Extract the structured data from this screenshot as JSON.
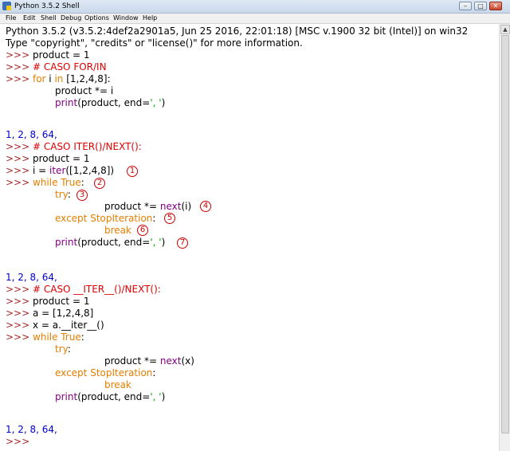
{
  "window": {
    "title": "Python 3.5.2 Shell",
    "icon": "python-icon"
  },
  "menu": [
    "File",
    "Edit",
    "Shell",
    "Debug",
    "Options",
    "Window",
    "Help"
  ],
  "shell": {
    "header1": "Python 3.5.2 (v3.5.2:4def2a2901a5, Jun 25 2016, 22:01:18) [MSC v.1900 32 bit (Intel)] on win32",
    "header2": "Type \"copyright\", \"credits\" or \"license()\" for more information.",
    "prompt": ">>> ",
    "b1": {
      "l1": "product = 1",
      "l2": "# CASO FOR/IN",
      "l3a": "for",
      "l3b": " i ",
      "l3c": "in",
      "l3d": " [1,2,4,8]:",
      "l4": "product *= i",
      "l5a": "print",
      "l5b": "(product, end=",
      "l5c": "', '",
      "l5d": ")"
    },
    "output1": "1, 2, 8, 64,",
    "b2": {
      "l1": "# CASO ITER()/NEXT():",
      "l2": "product = 1",
      "l3a": "i = ",
      "l3b": "iter",
      "l3c": "([1,2,4,8])",
      "l4a": "while",
      "l4b": " ",
      "l4c": "True",
      "l4d": ":",
      "l5a": "try",
      "l5b": ":",
      "l6a": "product *= ",
      "l6b": "next",
      "l6c": "(i)",
      "l7a": "except",
      "l7b": " ",
      "l7c": "StopIteration",
      "l7d": ":",
      "l8": "break",
      "l9a": "print",
      "l9b": "(product, end=",
      "l9c": "', '",
      "l9d": ")"
    },
    "markers": [
      "1",
      "2",
      "3",
      "4",
      "5",
      "6",
      "7"
    ],
    "output2": "1, 2, 8, 64,",
    "b3": {
      "l1": "# CASO __ITER__()/NEXT():",
      "l2": "product = 1",
      "l3": "a = [1,2,4,8]",
      "l4": "x = a.__iter__()",
      "l5a": "while",
      "l5b": " ",
      "l5c": "True",
      "l5d": ":",
      "l6a": "try",
      "l6b": ":",
      "l7a": "product *= ",
      "l7b": "next",
      "l7c": "(x)",
      "l8a": "except",
      "l8b": " ",
      "l8c": "StopIteration",
      "l8d": ":",
      "l9": "break",
      "l10a": "print",
      "l10b": "(product, end=",
      "l10c": "', '",
      "l10d": ")"
    },
    "output3": "1, 2, 8, 64,"
  },
  "colors": {
    "prompt": "#a52a2a",
    "keyword": "#e67e00",
    "builtin": "#800080",
    "comment": "#dd0000",
    "string": "#00aa00",
    "output": "#0000cc",
    "marker": "#cc0000"
  }
}
